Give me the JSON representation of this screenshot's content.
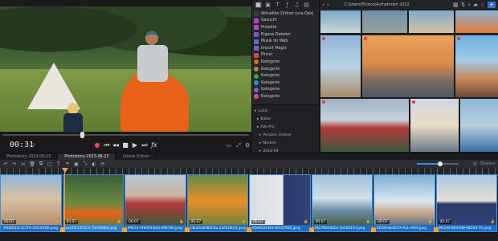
{
  "colors": {
    "accent": "#3a91e6",
    "playhead": "#f2a33a",
    "record": "#e24a5e",
    "marker": "#e83a4a"
  },
  "player": {
    "timecode": "00:31",
    "timecode_frames": "03",
    "transport_icons": [
      "record-icon",
      "skip-start-icon",
      "rewind-icon",
      "stop-icon",
      "play-icon",
      "skip-end-icon",
      "effects-icon"
    ],
    "right_icons": [
      "display-icon",
      "fullscreen-icon",
      "settings-icon"
    ]
  },
  "browser": {
    "tool_icons": [
      "grid-view-icon",
      "media-icon",
      "text-icon",
      "effects-icon",
      "music-icon",
      "template-icon"
    ],
    "folders": [
      {
        "label": "Aktuellen Ordner (usa.Ops)",
        "color": "#3a3c42"
      },
      {
        "label": "Gesucht",
        "color": "#c23bd1"
      },
      {
        "label": "Projekte",
        "color": "#a34dc8"
      },
      {
        "label": "Eigene Dateien",
        "color": "#7a5ac8"
      },
      {
        "label": "Musik im Web",
        "color": "#5b6fd0"
      },
      {
        "label": "Import Magix",
        "color": "#6b63c7"
      },
      {
        "label": "Pinsel",
        "color": "#d34747"
      },
      {
        "label": "Kategorie",
        "color": "#d06a2a"
      },
      {
        "label": "Kategorie",
        "color": "#c28a2a"
      },
      {
        "label": "Kategorie",
        "color": "#3fa35a"
      },
      {
        "label": "Kategorie",
        "color": "#2f8fd0"
      },
      {
        "label": "Kategorie",
        "color": "#8b5bd0"
      },
      {
        "label": "Kategorie",
        "color": "#d04f8c"
      }
    ],
    "tree": [
      "Lokal",
      "Bilder",
      "Alle Pro",
      "Persönl. Ordner",
      "Medien",
      "2018-09",
      "+10"
    ]
  },
  "grid": {
    "path": "C:\\Users\\Photos\\Aufnahmen 2022",
    "toolbar_icons": [
      "back-icon",
      "forward-icon",
      "up-icon",
      "view-grid-icon",
      "sort-icon",
      "filter-icon",
      "folder-icon",
      "star-icon",
      "list-icon",
      "details-icon",
      "import-icon"
    ]
  },
  "timeline": {
    "tabs": [
      "Photostory 2023-06-23",
      "Photostory 2023-06-23",
      "Urlaub Ordner"
    ],
    "toolbar_icons": [
      "undo-icon",
      "redo-icon",
      "cut-icon",
      "delete-icon",
      "copy-icon",
      "paste-icon",
      "title-icon",
      "crop-icon",
      "image-icon",
      "fit-icon",
      "mask-icon",
      "rotate-icon",
      "split-icon"
    ],
    "right_labels": [
      "Timeline"
    ],
    "zoom_level": 0.55,
    "clips": [
      {
        "duration": "00:07",
        "name": "IMG8543C3C5FA-2003AFB8.jpeg",
        "thumb": "family"
      },
      {
        "duration": "00:07",
        "name": "usa5fA1503C4-7bFAD6E6.jpeg",
        "thumb": "camp"
      },
      {
        "duration": "00:07",
        "name": "IMG7d+9bA0d-BA4-d66780.jpeg",
        "thumb": "binocular"
      },
      {
        "duration": "00:07",
        "name": "C8LbS48980C8a-23A6D8Dd.jpeg",
        "thumb": "tent"
      },
      {
        "duration": "00:07",
        "name": "IDeN6D29E8-8FE5FB6E.jpeg",
        "thumb": "window"
      },
      {
        "duration": "00:07",
        "name": "FAD7B0A4Ebk-3b5EE44d.jpeg",
        "thumb": "lake"
      },
      {
        "duration": "00:07",
        "name": "6EZ8A4bd01fA-ALL-A90F.jpeg",
        "thumb": "mountain"
      },
      {
        "duration": "00:07",
        "name": "MCD4C9D43B8-A8D4A 76.jpeg",
        "thumb": "beach"
      }
    ]
  }
}
